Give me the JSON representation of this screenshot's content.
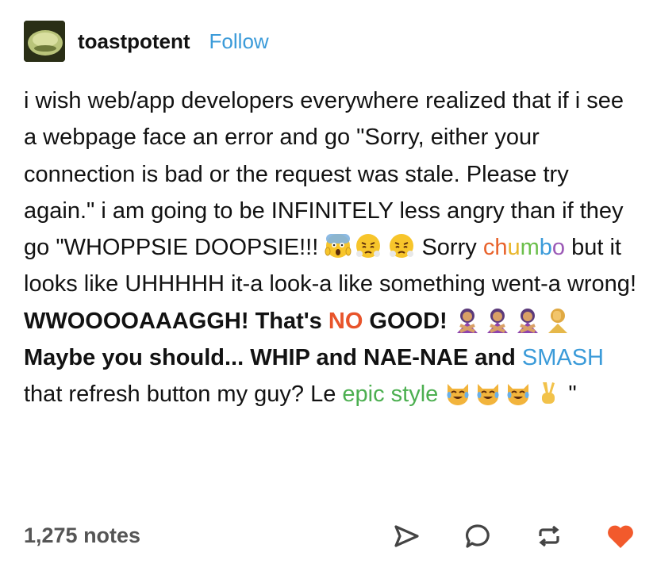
{
  "post": {
    "username": "toastpotent",
    "follow_label": "Follow",
    "segments": [
      {
        "text": "i wish web/app developers everywhere realized that if i see a webpage face an error and go \"Sorry, either your connection is bad or the request was stale. Please try again.\" i am going to be INFINITELY less angry than if they go \"WHOPPSIE DOOPSIE!!! ",
        "style": "normal"
      },
      {
        "text": " Sorry ",
        "style": "normal"
      },
      {
        "text": "chumbo",
        "style": "rainbow"
      },
      {
        "text": " but it looks like UHHHHH it-a look-a like something went-a wrong! ",
        "style": "normal"
      },
      {
        "text": "WWOOOOAAAGGH! That's ",
        "style": "bold"
      },
      {
        "text": "NO",
        "style": "bold-red"
      },
      {
        "text": " GOOD! ",
        "style": "bold"
      },
      {
        "text": " Maybe you should... WHIP and NAE-NAE and ",
        "style": "bold"
      },
      {
        "text": "SMASH",
        "style": "blue"
      },
      {
        "text": " that refresh button my guy? Le ",
        "style": "normal"
      },
      {
        "text": "epic style",
        "style": "green"
      },
      {
        "text": " \"",
        "style": "normal"
      }
    ],
    "chumbo_colors": [
      "#e8622b",
      "#e8622b",
      "#e8b62b",
      "#6bbf4a",
      "#3b9bd9",
      "#9b59b6"
    ],
    "colors": {
      "red": "#e8542b",
      "blue": "#3b9bd9",
      "green": "#4caf50",
      "heart": "#f25a2c"
    },
    "icons": [
      "shocked-face-icon",
      "steaming-face-icon",
      "steaming-face-icon",
      "crossed-arms-woman-icon",
      "crossed-arms-woman-icon",
      "crossed-arms-woman-icon",
      "facepalm-icon",
      "crying-laughing-cat-icon",
      "crying-laughing-cat-icon",
      "crying-laughing-cat-icon",
      "victory-hand-icon"
    ]
  },
  "footer": {
    "notes": "1,275 notes",
    "actions": [
      "share-icon",
      "reply-icon",
      "reblog-icon",
      "like-icon"
    ]
  }
}
